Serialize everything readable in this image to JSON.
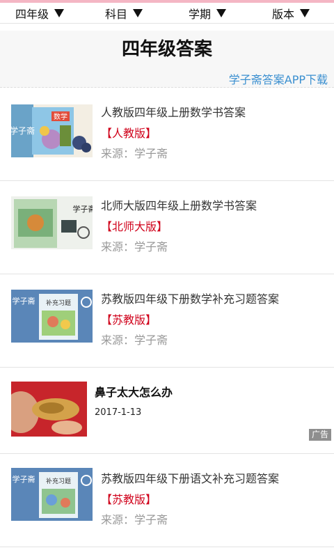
{
  "filters": [
    {
      "label": "四年级"
    },
    {
      "label": "科目"
    },
    {
      "label": "学期"
    },
    {
      "label": "版本"
    }
  ],
  "header": {
    "title": "四年级答案",
    "download_link": "学子斋答案APP下载"
  },
  "items": [
    {
      "title": "人教版四年级上册数学书答案",
      "tag": "【人教版】",
      "source": "来源：学子斋",
      "cover_text": "数学"
    },
    {
      "title": "北师大版四年级上册数学书答案",
      "tag": "【北师大版】",
      "source": "来源：学子斋",
      "cover_text": "学子斋"
    },
    {
      "title": "苏教版四年级下册数学补充习题答案",
      "tag": "【苏教版】",
      "source": "来源：学子斋",
      "cover_text": "补充习题"
    },
    {
      "title": "苏教版四年级下册语文补充习题答案",
      "tag": "【苏教版】",
      "source": "来源：学子斋",
      "cover_text": "补充习题"
    }
  ],
  "ad": {
    "title": "鼻子太大怎么办",
    "date": "2017-1-13",
    "badge": "广告"
  },
  "brand_label": "学子斋",
  "colors": {
    "accent_red": "#d0021b",
    "link_blue": "#3a8fd0",
    "top_line": "#f4b6c4"
  }
}
